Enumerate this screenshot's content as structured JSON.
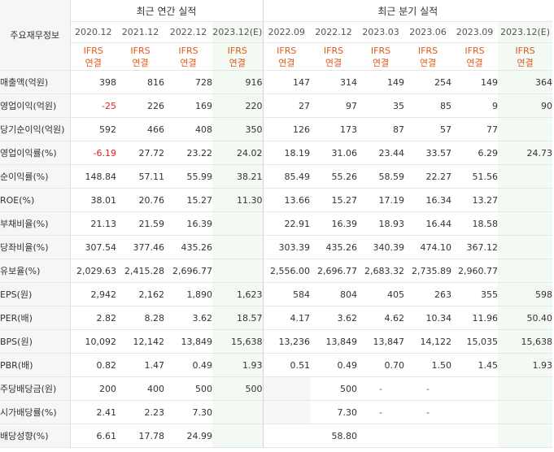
{
  "header": {
    "row_label": "주요재무정보",
    "annual_title": "최근 연간 실적",
    "quarterly_title": "최근 분기 실적",
    "standard_line1": "IFRS",
    "standard_line2": "연결"
  },
  "periods": [
    "2020.12",
    "2021.12",
    "2022.12",
    "2023.12(E)",
    "2022.09",
    "2022.12",
    "2023.03",
    "2023.06",
    "2023.09",
    "2023.12(E)"
  ],
  "rows": [
    {
      "label": "매출액(억원)",
      "values": [
        "398",
        "816",
        "728",
        "916",
        "147",
        "314",
        "149",
        "254",
        "149",
        "364"
      ]
    },
    {
      "label": "영업이익(억원)",
      "values": [
        "-25",
        "226",
        "169",
        "220",
        "27",
        "97",
        "35",
        "85",
        "9",
        "90"
      ]
    },
    {
      "label": "당기순이익(억원)",
      "values": [
        "592",
        "466",
        "408",
        "350",
        "126",
        "173",
        "87",
        "57",
        "77",
        ""
      ]
    },
    {
      "label": "영업이익률(%)",
      "values": [
        "-6.19",
        "27.72",
        "23.22",
        "24.02",
        "18.19",
        "31.06",
        "23.44",
        "33.57",
        "6.29",
        "24.73"
      ]
    },
    {
      "label": "순이익률(%)",
      "values": [
        "148.84",
        "57.11",
        "55.99",
        "38.21",
        "85.49",
        "55.26",
        "58.59",
        "22.27",
        "51.56",
        ""
      ]
    },
    {
      "label": "ROE(%)",
      "values": [
        "38.01",
        "20.76",
        "15.27",
        "11.30",
        "13.66",
        "15.27",
        "17.19",
        "16.34",
        "13.27",
        ""
      ]
    },
    {
      "label": "부채비율(%)",
      "values": [
        "21.13",
        "21.59",
        "16.39",
        "",
        "22.91",
        "16.39",
        "18.93",
        "16.44",
        "18.58",
        ""
      ]
    },
    {
      "label": "당좌비율(%)",
      "values": [
        "307.54",
        "377.46",
        "435.26",
        "",
        "303.39",
        "435.26",
        "340.39",
        "474.10",
        "367.12",
        ""
      ]
    },
    {
      "label": "유보율(%)",
      "values": [
        "2,029.63",
        "2,415.28",
        "2,696.77",
        "",
        "2,556.00",
        "2,696.77",
        "2,683.32",
        "2,735.89",
        "2,960.77",
        ""
      ]
    },
    {
      "label": "EPS(원)",
      "values": [
        "2,942",
        "2,162",
        "1,890",
        "1,623",
        "584",
        "804",
        "405",
        "263",
        "355",
        "598"
      ]
    },
    {
      "label": "PER(배)",
      "values": [
        "2.82",
        "8.28",
        "3.62",
        "18.57",
        "4.17",
        "3.62",
        "4.62",
        "10.34",
        "11.96",
        "50.40"
      ]
    },
    {
      "label": "BPS(원)",
      "values": [
        "10,092",
        "12,142",
        "13,849",
        "15,638",
        "13,236",
        "13,849",
        "13,847",
        "14,122",
        "15,035",
        "15,638"
      ]
    },
    {
      "label": "PBR(배)",
      "values": [
        "0.82",
        "1.47",
        "0.49",
        "1.93",
        "0.51",
        "0.49",
        "0.70",
        "1.50",
        "1.45",
        "1.93"
      ]
    },
    {
      "label": "주당배당금(원)",
      "values": [
        "200",
        "400",
        "500",
        "500",
        "",
        "500",
        "-",
        "-",
        "",
        ""
      ]
    },
    {
      "label": "시가배당률(%)",
      "values": [
        "2.41",
        "2.23",
        "7.30",
        "",
        "",
        "7.30",
        "-",
        "-",
        "",
        ""
      ]
    },
    {
      "label": "배당성향(%)",
      "values": [
        "6.61",
        "17.78",
        "24.99",
        "",
        "",
        "58.80",
        "",
        "",
        "",
        ""
      ]
    }
  ]
}
